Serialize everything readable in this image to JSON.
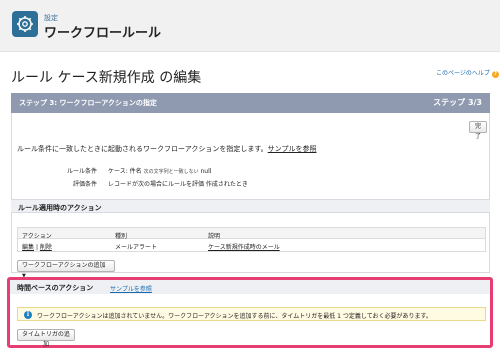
{
  "header": {
    "super_label": "設定",
    "title": "ワークフロールール",
    "icon": "gear-icon"
  },
  "page": {
    "title": "ルール ケース新規作成 の編集",
    "help_link": "このページのヘルプ",
    "help_icon": "question-icon"
  },
  "step": {
    "title": "ステップ 3: ワークフローアクションの指定",
    "counter": "ステップ 3/3",
    "done_button": "完了"
  },
  "description": {
    "text": "ルール条件に一致したときに起動されるワークフローアクションを指定します。",
    "link": "サンプルを参照"
  },
  "rule": {
    "condition_label": "ルール条件",
    "condition_value": "ケース: 件名",
    "condition_op": "次の文字列と一致しない",
    "condition_target": "null",
    "eval_label": "評価条件",
    "eval_value": "レコードが次の場合にルールを評価 作成されたとき"
  },
  "immediate_actions": {
    "heading": "ルール適用時のアクション",
    "columns": [
      "アクション",
      "種別",
      "説明"
    ],
    "rows": [
      {
        "edit": "編集",
        "sep": "|",
        "delete": "削除",
        "type": "メールアラート",
        "description": "ケース新規作成時のメール"
      }
    ],
    "add_button": "ワークフローアクションの追加",
    "add_arrow": "▼"
  },
  "time_actions": {
    "heading": "時間ベースのアクション",
    "link": "サンプルを参照",
    "info_icon": "info-icon",
    "info_text": "ワークフローアクションは追加されていません。ワークフローアクションを追加する前に、タイムトリガを最低 1 つ定義しておく必要があります。",
    "add_trigger_button": "タイムトリガの追加"
  },
  "colors": {
    "step_bar": "#8f9ab0",
    "highlight": "#e63e72",
    "link": "#1a6ab0",
    "info_bg": "#fffbe2"
  }
}
